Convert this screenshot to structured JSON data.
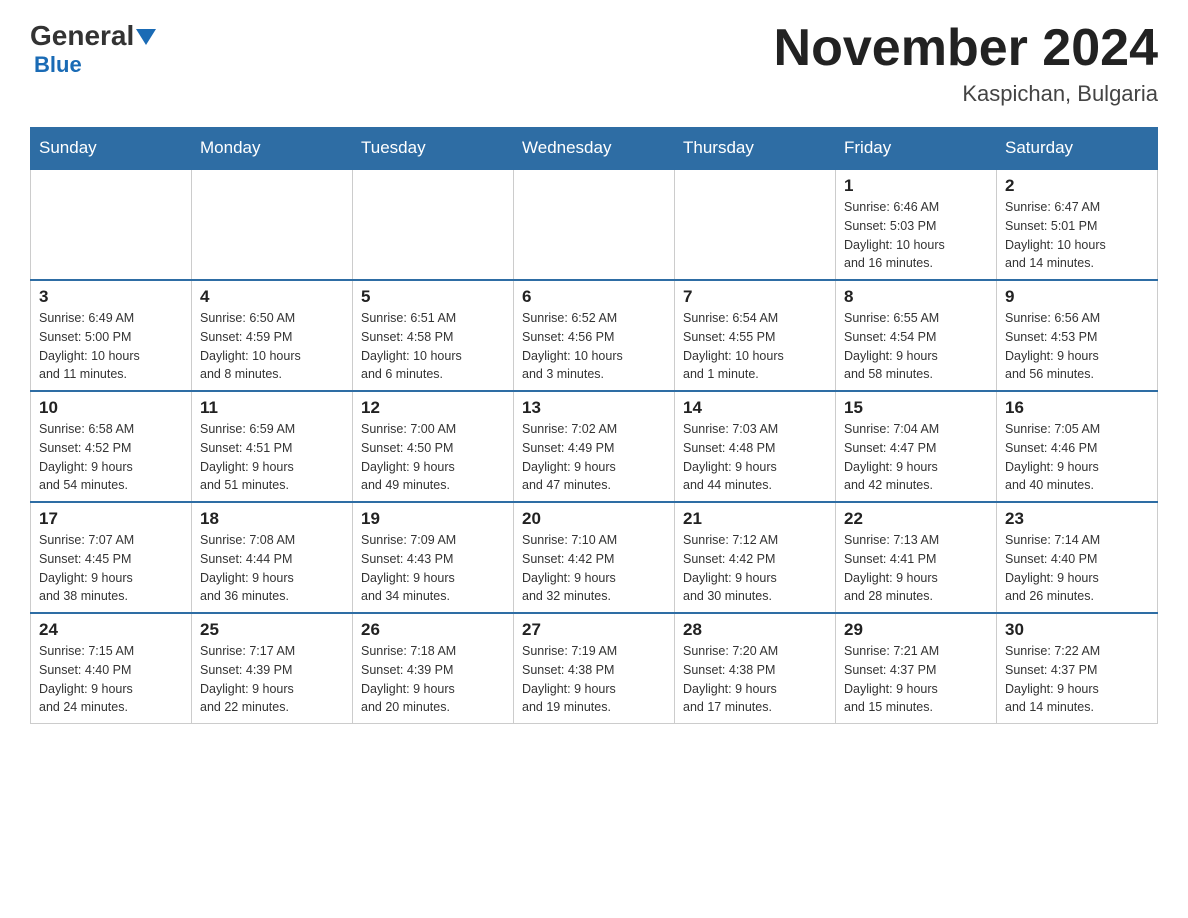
{
  "header": {
    "logo_general": "General",
    "logo_blue": "Blue",
    "month_title": "November 2024",
    "location": "Kaspichan, Bulgaria"
  },
  "weekdays": [
    "Sunday",
    "Monday",
    "Tuesday",
    "Wednesday",
    "Thursday",
    "Friday",
    "Saturday"
  ],
  "weeks": [
    [
      {
        "day": "",
        "info": ""
      },
      {
        "day": "",
        "info": ""
      },
      {
        "day": "",
        "info": ""
      },
      {
        "day": "",
        "info": ""
      },
      {
        "day": "",
        "info": ""
      },
      {
        "day": "1",
        "info": "Sunrise: 6:46 AM\nSunset: 5:03 PM\nDaylight: 10 hours\nand 16 minutes."
      },
      {
        "day": "2",
        "info": "Sunrise: 6:47 AM\nSunset: 5:01 PM\nDaylight: 10 hours\nand 14 minutes."
      }
    ],
    [
      {
        "day": "3",
        "info": "Sunrise: 6:49 AM\nSunset: 5:00 PM\nDaylight: 10 hours\nand 11 minutes."
      },
      {
        "day": "4",
        "info": "Sunrise: 6:50 AM\nSunset: 4:59 PM\nDaylight: 10 hours\nand 8 minutes."
      },
      {
        "day": "5",
        "info": "Sunrise: 6:51 AM\nSunset: 4:58 PM\nDaylight: 10 hours\nand 6 minutes."
      },
      {
        "day": "6",
        "info": "Sunrise: 6:52 AM\nSunset: 4:56 PM\nDaylight: 10 hours\nand 3 minutes."
      },
      {
        "day": "7",
        "info": "Sunrise: 6:54 AM\nSunset: 4:55 PM\nDaylight: 10 hours\nand 1 minute."
      },
      {
        "day": "8",
        "info": "Sunrise: 6:55 AM\nSunset: 4:54 PM\nDaylight: 9 hours\nand 58 minutes."
      },
      {
        "day": "9",
        "info": "Sunrise: 6:56 AM\nSunset: 4:53 PM\nDaylight: 9 hours\nand 56 minutes."
      }
    ],
    [
      {
        "day": "10",
        "info": "Sunrise: 6:58 AM\nSunset: 4:52 PM\nDaylight: 9 hours\nand 54 minutes."
      },
      {
        "day": "11",
        "info": "Sunrise: 6:59 AM\nSunset: 4:51 PM\nDaylight: 9 hours\nand 51 minutes."
      },
      {
        "day": "12",
        "info": "Sunrise: 7:00 AM\nSunset: 4:50 PM\nDaylight: 9 hours\nand 49 minutes."
      },
      {
        "day": "13",
        "info": "Sunrise: 7:02 AM\nSunset: 4:49 PM\nDaylight: 9 hours\nand 47 minutes."
      },
      {
        "day": "14",
        "info": "Sunrise: 7:03 AM\nSunset: 4:48 PM\nDaylight: 9 hours\nand 44 minutes."
      },
      {
        "day": "15",
        "info": "Sunrise: 7:04 AM\nSunset: 4:47 PM\nDaylight: 9 hours\nand 42 minutes."
      },
      {
        "day": "16",
        "info": "Sunrise: 7:05 AM\nSunset: 4:46 PM\nDaylight: 9 hours\nand 40 minutes."
      }
    ],
    [
      {
        "day": "17",
        "info": "Sunrise: 7:07 AM\nSunset: 4:45 PM\nDaylight: 9 hours\nand 38 minutes."
      },
      {
        "day": "18",
        "info": "Sunrise: 7:08 AM\nSunset: 4:44 PM\nDaylight: 9 hours\nand 36 minutes."
      },
      {
        "day": "19",
        "info": "Sunrise: 7:09 AM\nSunset: 4:43 PM\nDaylight: 9 hours\nand 34 minutes."
      },
      {
        "day": "20",
        "info": "Sunrise: 7:10 AM\nSunset: 4:42 PM\nDaylight: 9 hours\nand 32 minutes."
      },
      {
        "day": "21",
        "info": "Sunrise: 7:12 AM\nSunset: 4:42 PM\nDaylight: 9 hours\nand 30 minutes."
      },
      {
        "day": "22",
        "info": "Sunrise: 7:13 AM\nSunset: 4:41 PM\nDaylight: 9 hours\nand 28 minutes."
      },
      {
        "day": "23",
        "info": "Sunrise: 7:14 AM\nSunset: 4:40 PM\nDaylight: 9 hours\nand 26 minutes."
      }
    ],
    [
      {
        "day": "24",
        "info": "Sunrise: 7:15 AM\nSunset: 4:40 PM\nDaylight: 9 hours\nand 24 minutes."
      },
      {
        "day": "25",
        "info": "Sunrise: 7:17 AM\nSunset: 4:39 PM\nDaylight: 9 hours\nand 22 minutes."
      },
      {
        "day": "26",
        "info": "Sunrise: 7:18 AM\nSunset: 4:39 PM\nDaylight: 9 hours\nand 20 minutes."
      },
      {
        "day": "27",
        "info": "Sunrise: 7:19 AM\nSunset: 4:38 PM\nDaylight: 9 hours\nand 19 minutes."
      },
      {
        "day": "28",
        "info": "Sunrise: 7:20 AM\nSunset: 4:38 PM\nDaylight: 9 hours\nand 17 minutes."
      },
      {
        "day": "29",
        "info": "Sunrise: 7:21 AM\nSunset: 4:37 PM\nDaylight: 9 hours\nand 15 minutes."
      },
      {
        "day": "30",
        "info": "Sunrise: 7:22 AM\nSunset: 4:37 PM\nDaylight: 9 hours\nand 14 minutes."
      }
    ]
  ]
}
